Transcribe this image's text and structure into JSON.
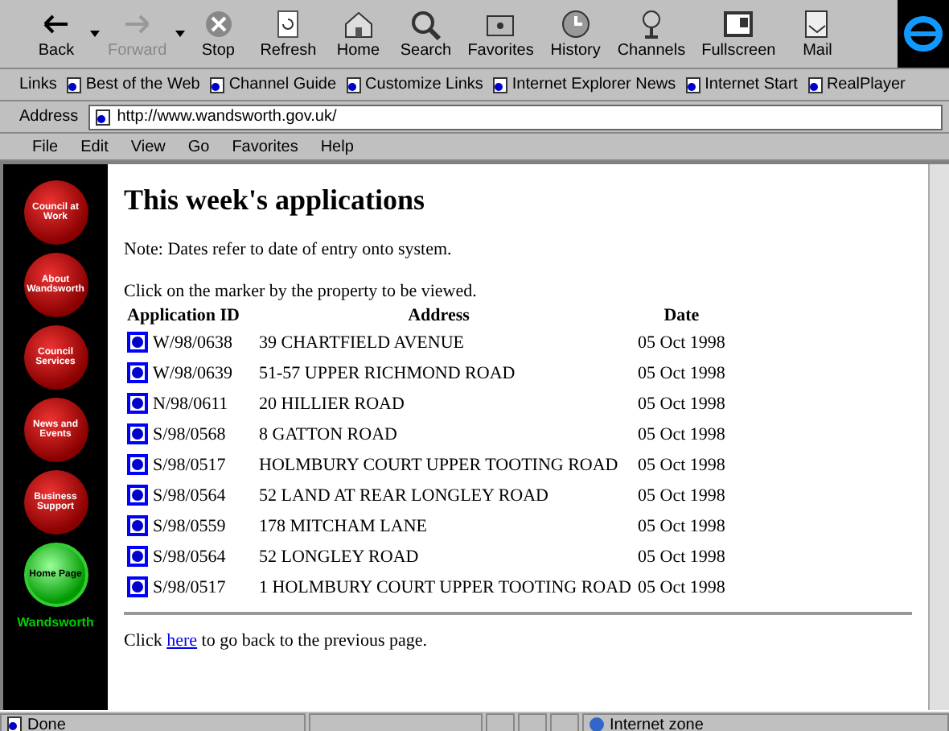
{
  "toolbar": {
    "buttons": [
      {
        "label": "Back",
        "kind": "back",
        "disabled": false,
        "dropdown": true
      },
      {
        "label": "Forward",
        "kind": "forward",
        "disabled": true,
        "dropdown": true
      },
      {
        "label": "Stop",
        "kind": "stop",
        "disabled": false,
        "dropdown": false
      },
      {
        "label": "Refresh",
        "kind": "refresh",
        "disabled": false,
        "dropdown": false
      },
      {
        "label": "Home",
        "kind": "home",
        "disabled": false,
        "dropdown": false
      },
      {
        "label": "Search",
        "kind": "search",
        "disabled": false,
        "dropdown": false
      },
      {
        "label": "Favorites",
        "kind": "favorites",
        "disabled": false,
        "dropdown": false
      },
      {
        "label": "History",
        "kind": "history",
        "disabled": false,
        "dropdown": false
      },
      {
        "label": "Channels",
        "kind": "channels",
        "disabled": false,
        "dropdown": false
      },
      {
        "label": "Fullscreen",
        "kind": "fullscreen",
        "disabled": false,
        "dropdown": false
      },
      {
        "label": "Mail",
        "kind": "mail",
        "disabled": false,
        "dropdown": false
      }
    ]
  },
  "links_bar": {
    "label": "Links",
    "links": [
      "Best of the Web",
      "Channel Guide",
      "Customize Links",
      "Internet Explorer News",
      "Internet Start",
      "RealPlayer"
    ]
  },
  "address_bar": {
    "label": "Address",
    "value": "http://www.wandsworth.gov.uk/"
  },
  "menu_bar": [
    "File",
    "Edit",
    "View",
    "Go",
    "Favorites",
    "Help"
  ],
  "sidebar": {
    "buttons": [
      {
        "label": "Council at Work",
        "kind": "red"
      },
      {
        "label": "About Wandsworth",
        "kind": "red"
      },
      {
        "label": "Council Services",
        "kind": "red"
      },
      {
        "label": "News and Events",
        "kind": "red"
      },
      {
        "label": "Business Support",
        "kind": "red"
      },
      {
        "label": "Home Page",
        "kind": "green"
      }
    ],
    "caption": "Wandsworth"
  },
  "page": {
    "title": "This week's applications",
    "note": "Note: Dates refer to date of entry onto system.",
    "instruction": "Click on the marker by the property to be viewed.",
    "table": {
      "columns": [
        "Application ID",
        "Address",
        "Date"
      ],
      "rows": [
        [
          "W/98/0638",
          "39 CHARTFIELD AVENUE",
          "05 Oct 1998"
        ],
        [
          "W/98/0639",
          "51-57 UPPER RICHMOND ROAD",
          "05 Oct 1998"
        ],
        [
          "N/98/0611",
          "20 HILLIER ROAD",
          "05 Oct 1998"
        ],
        [
          "S/98/0568",
          "8 GATTON ROAD",
          "05 Oct 1998"
        ],
        [
          "S/98/0517",
          "HOLMBURY COURT UPPER TOOTING ROAD",
          "05 Oct 1998"
        ],
        [
          "S/98/0564",
          "52 LAND AT REAR LONGLEY ROAD",
          "05 Oct 1998"
        ],
        [
          "S/98/0559",
          "178 MITCHAM LANE",
          "05 Oct 1998"
        ],
        [
          "S/98/0564",
          "52 LONGLEY ROAD",
          "05 Oct 1998"
        ],
        [
          "S/98/0517",
          "1 HOLMBURY COURT UPPER TOOTING ROAD",
          "05 Oct 1998"
        ]
      ]
    },
    "back_text_before": "Click",
    "back_link": "here",
    "back_text_after": "to go back to the previous page."
  },
  "status_bar": {
    "text": "Done",
    "zone": "Internet zone"
  }
}
